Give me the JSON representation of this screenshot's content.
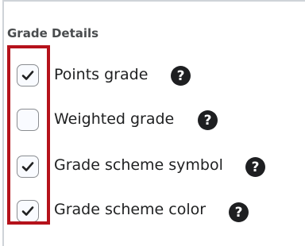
{
  "section": {
    "title": "Grade Details"
  },
  "options": [
    {
      "label": "Points grade",
      "checked": true,
      "help_icon": "question-circle-icon"
    },
    {
      "label": "Weighted grade",
      "checked": false,
      "help_icon": "question-circle-icon"
    },
    {
      "label": "Grade scheme symbol",
      "checked": true,
      "help_icon": "question-circle-icon"
    },
    {
      "label": "Grade scheme color",
      "checked": true,
      "help_icon": "question-circle-icon"
    }
  ],
  "colors": {
    "highlight": "#b5121b",
    "help_icon_bg": "#1e1f21",
    "checkbox_border": "#8a8d91"
  }
}
